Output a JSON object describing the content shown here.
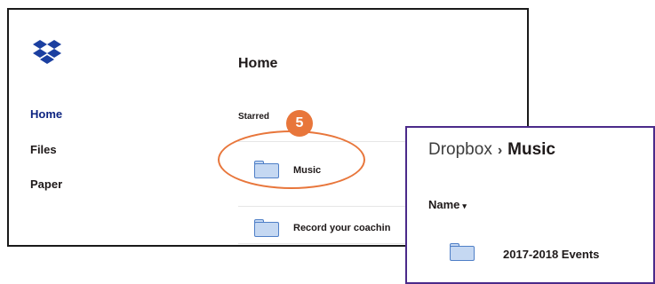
{
  "sidebar": {
    "logo_icon": "dropbox-logo-icon",
    "items": [
      {
        "label": "Home",
        "active": true
      },
      {
        "label": "Files",
        "active": false
      },
      {
        "label": "Paper",
        "active": false
      }
    ]
  },
  "main": {
    "title": "Home",
    "starred_label": "Starred",
    "rows": [
      {
        "label": "Music",
        "icon": "folder-icon"
      },
      {
        "label": "Record your coachin",
        "icon": "folder-icon"
      }
    ]
  },
  "callout": {
    "step_number": "5",
    "color": "#e8763b"
  },
  "popup": {
    "breadcrumb": {
      "root": "Dropbox",
      "separator": "›",
      "current": "Music"
    },
    "column_header": "Name",
    "sort_indicator": "▾",
    "rows": [
      {
        "label": "2017-2018 Events",
        "icon": "folder-icon"
      }
    ],
    "border_color": "#4b2a8a"
  },
  "colors": {
    "active_nav": "#0d2481",
    "folder_fill": "#c5d8f2",
    "folder_stroke": "#4f7fc7"
  }
}
